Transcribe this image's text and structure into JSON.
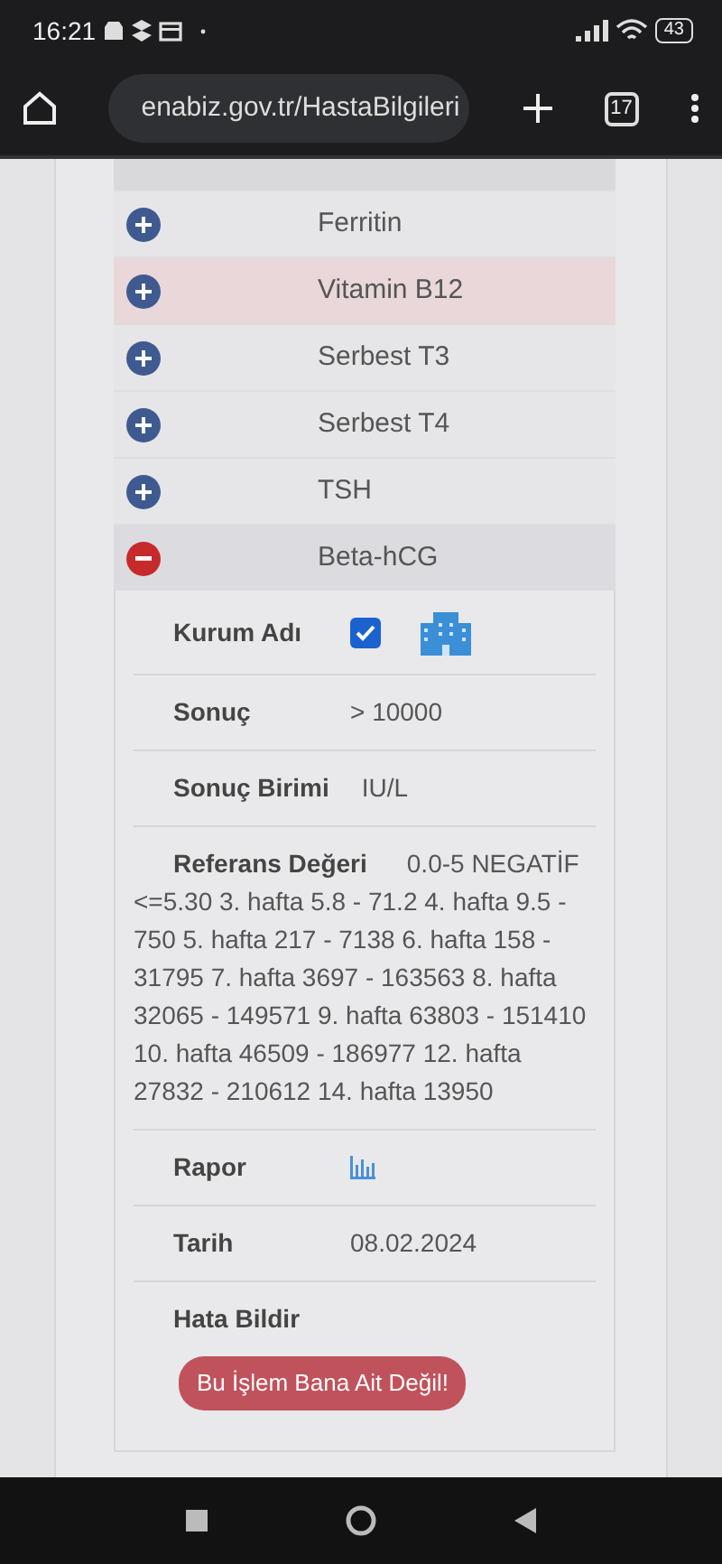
{
  "status_bar": {
    "time": "16:21",
    "battery": "43"
  },
  "browser": {
    "url": "enabiz.gov.tr/HastaBilgileri",
    "tab_count": "17"
  },
  "tests": [
    {
      "name": "Ferritin",
      "expanded": false,
      "highlighted": false
    },
    {
      "name": "Vitamin B12",
      "expanded": false,
      "highlighted": true
    },
    {
      "name": "Serbest T3",
      "expanded": false,
      "highlighted": false
    },
    {
      "name": "Serbest T4",
      "expanded": false,
      "highlighted": false
    },
    {
      "name": "TSH",
      "expanded": false,
      "highlighted": false
    },
    {
      "name": "Beta-hCG",
      "expanded": true,
      "highlighted": false
    }
  ],
  "details": [
    {
      "kind": "checkbox",
      "label": "Kurum Adı",
      "checked": true
    },
    {
      "kind": "text",
      "label": "Sonuç",
      "value": "> 10000"
    },
    {
      "kind": "text",
      "label": "Sonuç Birimi",
      "value": "IU/L"
    },
    {
      "kind": "long",
      "label": "Referans Değeri",
      "value": "0.0-5 NEGATİF <=5.30 3. hafta 5.8 - 71.2 4. hafta 9.5 - 750 5. hafta 217 - 7138 6. hafta 158 - 31795 7. hafta 3697 - 163563 8. hafta 32065 - 149571 9. hafta 63803 - 151410 10. hafta 46509 - 186977 12. hafta 27832 - 210612 14. hafta 13950"
    },
    {
      "kind": "report",
      "label": "Rapor"
    },
    {
      "kind": "text",
      "label": "Tarih",
      "value": "08.02.2024"
    },
    {
      "kind": "button",
      "label": "Hata Bildir",
      "button": "Bu İşlem Bana Ait Değil!"
    }
  ]
}
